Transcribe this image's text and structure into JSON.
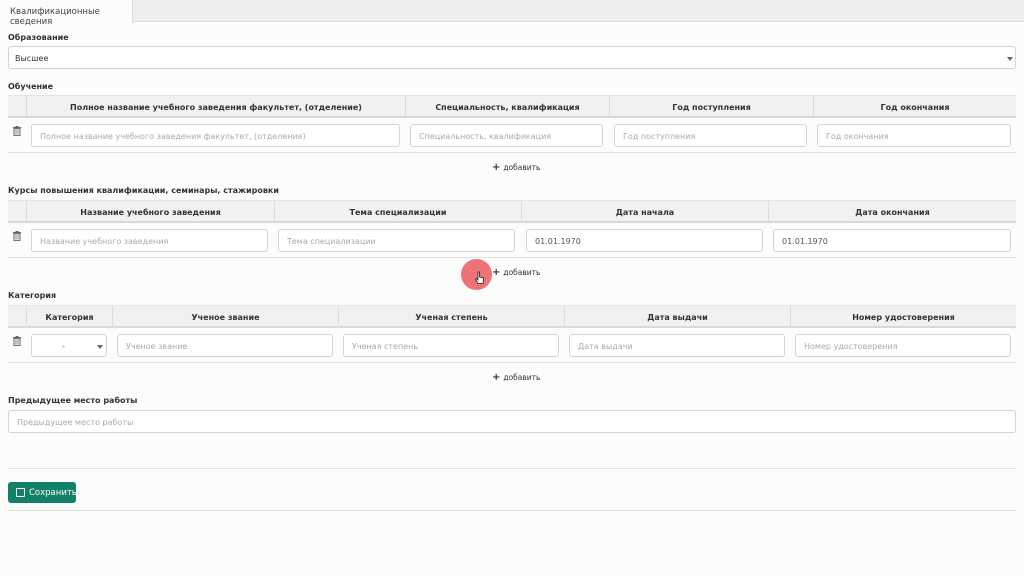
{
  "tab": {
    "label": "Квалификационные сведения"
  },
  "education": {
    "label": "Образование",
    "value": "Высшее"
  },
  "training": {
    "label": "Обучение",
    "columns": [
      "Полное название учебного заведения факультет, (отделение)",
      "Специальность, квалификация",
      "Год поступления",
      "Год окончания"
    ],
    "placeholders": [
      "Полное название учебного заведения факультет, (отделение)",
      "Специальность, квалификация",
      "Год поступления",
      "Год окончания"
    ],
    "add_label": "добавить"
  },
  "courses": {
    "label": "Курсы повышения квалификации, семинары, стажировки",
    "columns": [
      "Название учебного заведения",
      "Тема специализации",
      "Дата начала",
      "Дата окончания"
    ],
    "placeholders": [
      "Название учебного заведения",
      "Тема специализации"
    ],
    "start_date": "01.01.1970",
    "end_date": "01.01.1970",
    "add_label": "добавить"
  },
  "category": {
    "label": "Категория",
    "columns": [
      "Категория",
      "Ученое звание",
      "Ученая степень",
      "Дата выдачи",
      "Номер удостоверения"
    ],
    "select_value": "-",
    "placeholders": [
      "Ученое звание",
      "Ученая степень",
      "Дата выдачи",
      "Номер удостоверения"
    ],
    "add_label": "добавить"
  },
  "previous_job": {
    "label": "Предыдущее место работы",
    "placeholder": "Предыдущее место работы"
  },
  "save_label": "Сохранить",
  "icons": {
    "trash": "trash-icon",
    "plus": "plus-icon",
    "save": "floppy-icon",
    "caret": "caret-down-icon"
  },
  "colors": {
    "primary": "#15806a",
    "cursor_highlight": "#eb5a5f"
  }
}
